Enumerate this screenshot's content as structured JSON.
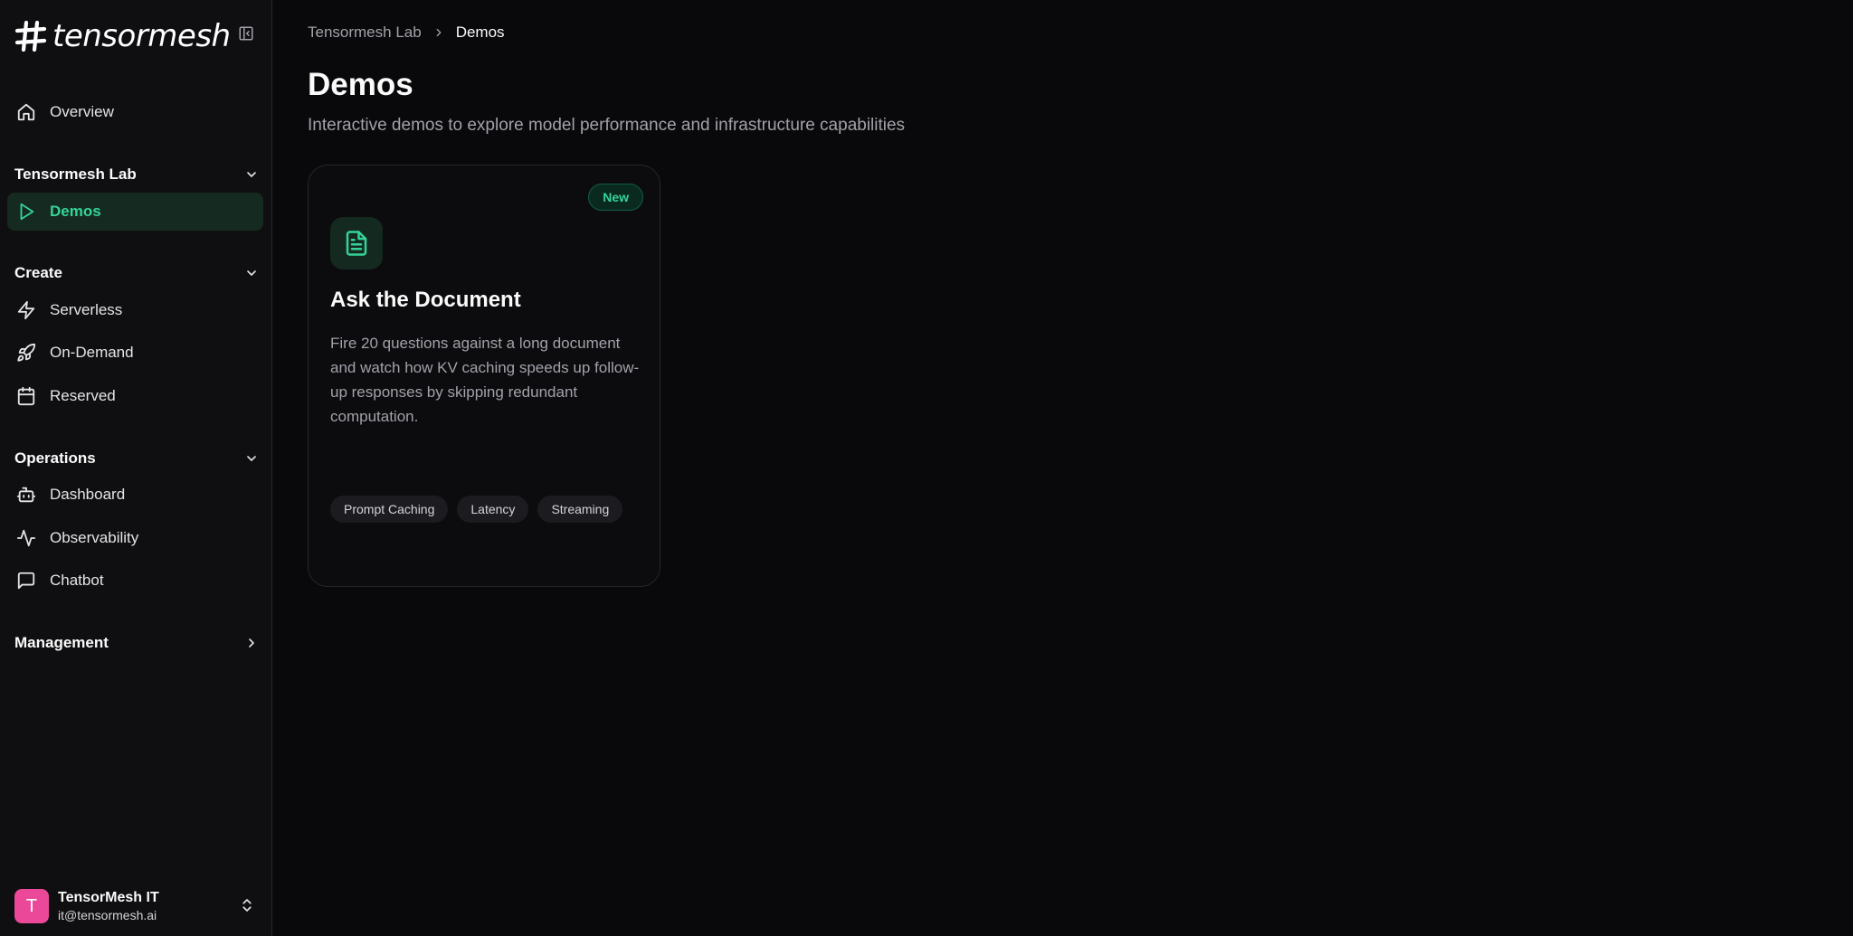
{
  "brand": {
    "name": "tensormesh"
  },
  "sidebar": {
    "overview": {
      "label": "Overview"
    },
    "sections": [
      {
        "title": "Tensormesh Lab",
        "items": [
          {
            "label": "Demos",
            "icon": "play-icon"
          }
        ]
      },
      {
        "title": "Create",
        "items": [
          {
            "label": "Serverless",
            "icon": "zap-icon"
          },
          {
            "label": "On-Demand",
            "icon": "rocket-icon"
          },
          {
            "label": "Reserved",
            "icon": "calendar-icon"
          }
        ]
      },
      {
        "title": "Operations",
        "items": [
          {
            "label": "Dashboard",
            "icon": "bot-icon"
          },
          {
            "label": "Observability",
            "icon": "activity-icon"
          },
          {
            "label": "Chatbot",
            "icon": "message-square-icon"
          }
        ]
      },
      {
        "title": "Management",
        "items": []
      }
    ]
  },
  "user": {
    "initial": "T",
    "name": "TensorMesh IT",
    "email": "it@tensormesh.ai"
  },
  "breadcrumb": {
    "parent": "Tensormesh Lab",
    "current": "Demos"
  },
  "page": {
    "title": "Demos",
    "subtitle": "Interactive demos to explore model performance and infrastructure capabilities"
  },
  "demo_card": {
    "badge": "New",
    "title": "Ask the Document",
    "description": "Fire 20 questions against a long document and watch how KV caching speeds up follow-up responses by skipping redundant computation.",
    "tags": [
      "Prompt Caching",
      "Latency",
      "Streaming"
    ]
  },
  "colors": {
    "accent": "#34d399",
    "active_bg": "#152a20",
    "avatar": "#ec4899",
    "background": "#09090b",
    "sidebar": "#0f0f12"
  }
}
